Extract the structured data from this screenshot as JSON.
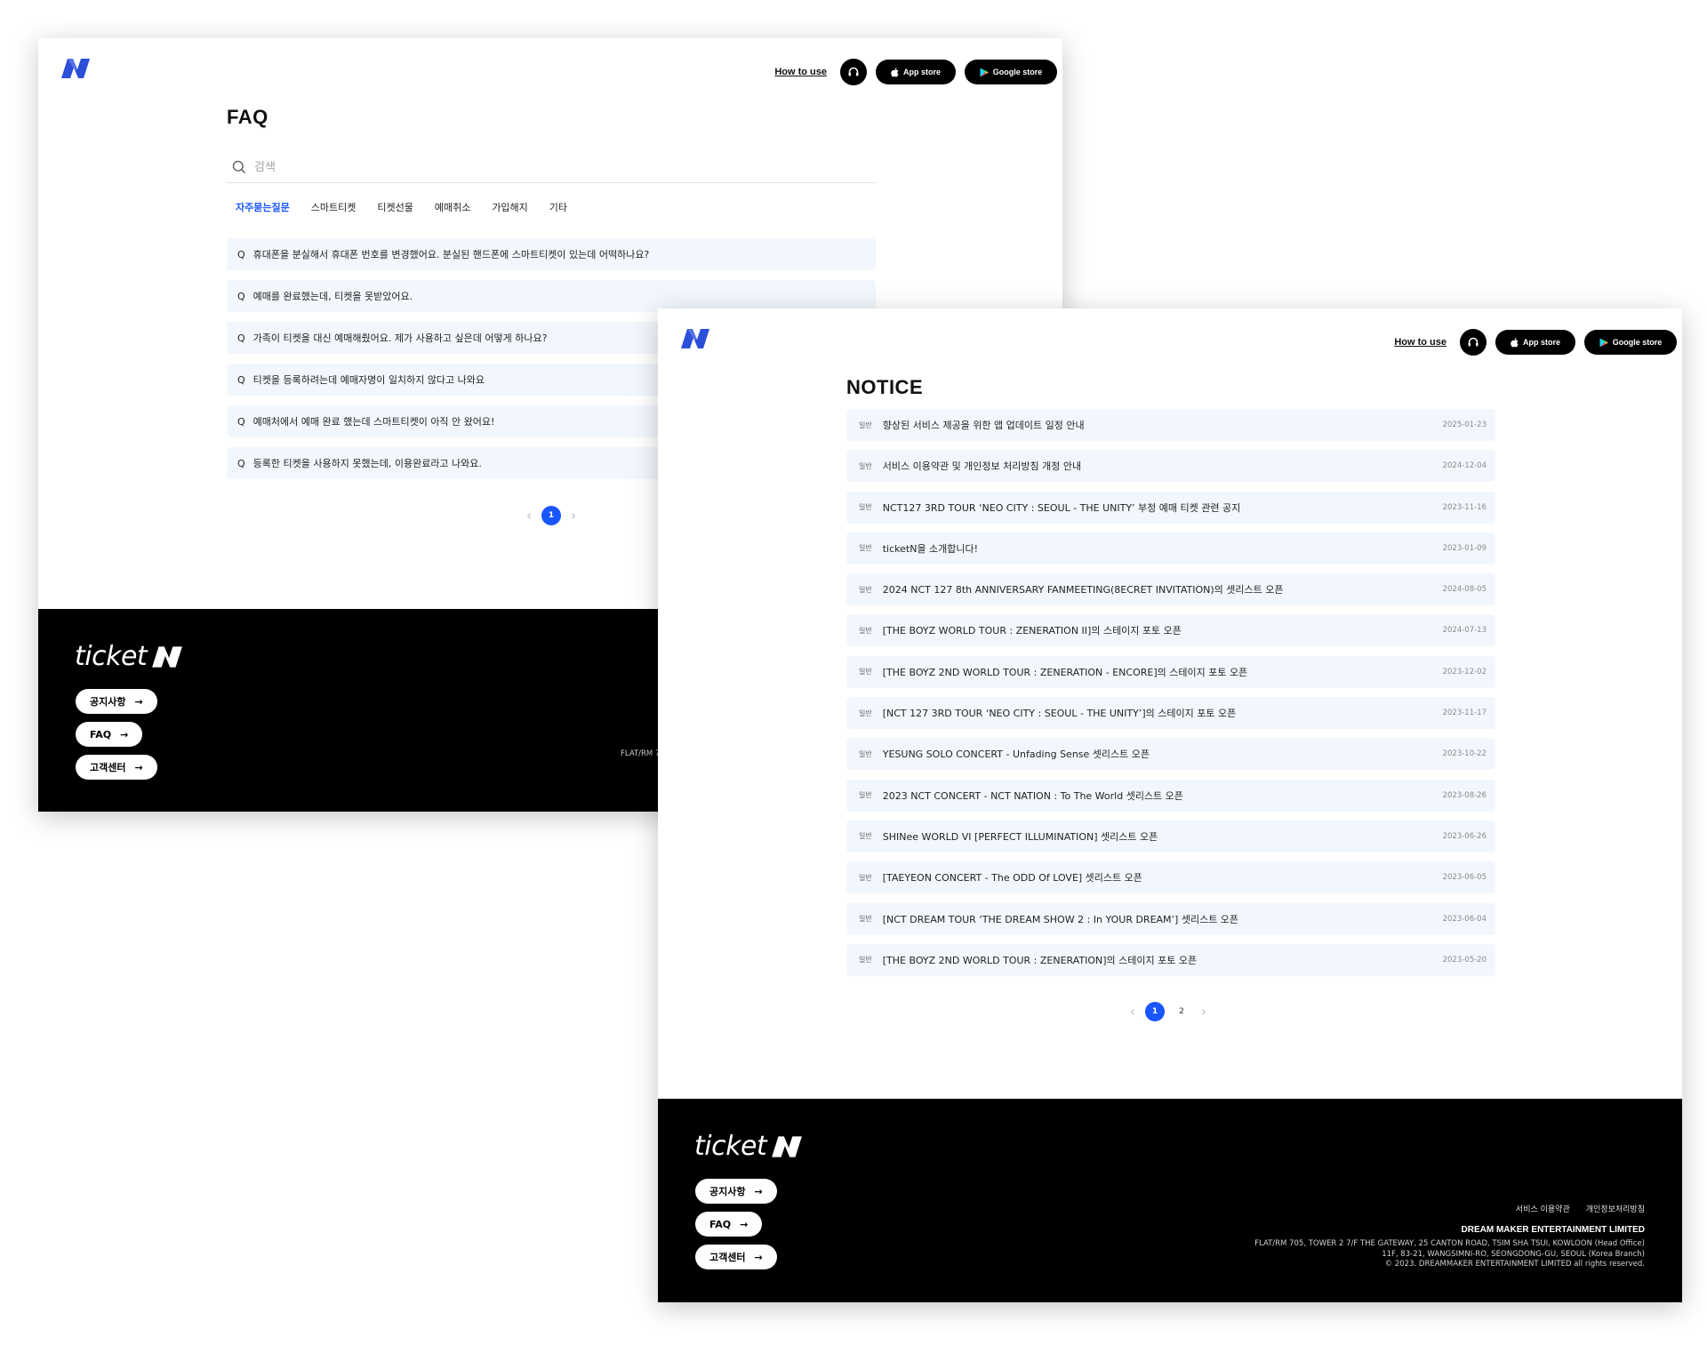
{
  "header": {
    "how_to_use": "How to use",
    "app_store": "App store",
    "google_store": "Google store"
  },
  "faq": {
    "title": "FAQ",
    "search_placeholder": "검색",
    "tabs": [
      "자주묻는질문",
      "스마트티켓",
      "티켓선물",
      "예매취소",
      "가입해지",
      "기타"
    ],
    "active_tab": "자주묻는질문",
    "items": [
      "휴대폰을 분실해서 휴대폰 번호를 변경했어요. 분실된 핸드폰에 스마트티켓이 있는데 어떡하나요?",
      "예매를 완료했는데, 티켓을 못받았어요.",
      "가족이 티켓을 대신 예매해줬어요. 제가 사용하고 싶은데 어떻게 하나요?",
      "티켓을 등록하려는데 예매자명이 일치하지 않다고 나와요",
      "예매처에서 예매 완료 했는데 스마트티켓이 아직 안 왔어요!",
      "등록한 티켓을 사용하지 못했는데, 이용완료라고 나와요."
    ],
    "q_prefix": "Q",
    "pages": [
      "1"
    ],
    "current_page": "1",
    "footer_addr_fragment": "FLAT/RM 7"
  },
  "notice": {
    "title": "NOTICE",
    "items": [
      {
        "category": "일반",
        "title": "향상된 서비스 제공을 위한 앱 업데이트 일정 안내",
        "date": "2025-01-23"
      },
      {
        "category": "일반",
        "title": "서비스 이용약관 및 개인정보 처리방침 개정 안내",
        "date": "2024-12-04"
      },
      {
        "category": "일반",
        "title": "NCT127 3RD TOUR ‘NEO CITY : SEOUL - THE UNITY’ 부정 예매 티켓 관련 공지",
        "date": "2023-11-16"
      },
      {
        "category": "일반",
        "title": "ticketN을 소개합니다!",
        "date": "2023-01-09"
      },
      {
        "category": "일반",
        "title": "2024 NCT 127 8th ANNIVERSARY FANMEETING(8ECRET INVITATION)의 셋리스트 오픈",
        "date": "2024-08-05"
      },
      {
        "category": "일반",
        "title": "[THE BOYZ WORLD TOUR : ZENERATION II]의 스테이지 포토 오픈",
        "date": "2024-07-13"
      },
      {
        "category": "일반",
        "title": "[THE BOYZ 2ND WORLD TOUR : ZENERATION - ENCORE]의 스테이지 포토 오픈",
        "date": "2023-12-02"
      },
      {
        "category": "일반",
        "title": "[NCT 127 3RD TOUR ‘NEO CITY : SEOUL - THE UNITY’]의 스테이지 포토 오픈",
        "date": "2023-11-17"
      },
      {
        "category": "일반",
        "title": "YESUNG SOLO CONCERT - Unfading Sense 셋리스트 오픈",
        "date": "2023-10-22"
      },
      {
        "category": "일반",
        "title": "2023 NCT CONCERT - NCT NATION : To The World 셋리스트 오픈",
        "date": "2023-08-26"
      },
      {
        "category": "일반",
        "title": "SHINee WORLD VI [PERFECT ILLUMINATION] 셋리스트 오픈",
        "date": "2023-06-26"
      },
      {
        "category": "일반",
        "title": "[TAEYEON CONCERT - The ODD Of LOVE] 셋리스트 오픈",
        "date": "2023-06-05"
      },
      {
        "category": "일반",
        "title": "[NCT DREAM TOUR ‘THE DREAM SHOW 2 : In YOUR DREAM’] 셋리스트 오픈",
        "date": "2023-06-04"
      },
      {
        "category": "일반",
        "title": "[THE BOYZ 2ND WORLD TOUR : ZENERATION]의 스테이지 포토 오픈",
        "date": "2023-05-20"
      }
    ],
    "pages": [
      "1",
      "2"
    ],
    "current_page": "1"
  },
  "footer": {
    "brand": "ticket",
    "links": [
      "공지사항",
      "FAQ",
      "고객센터"
    ],
    "terms": "서비스 이용약관",
    "privacy": "개인정보처리방침",
    "company": "DREAM MAKER ENTERTAINMENT LIMITED",
    "address_lines": [
      "FLAT/RM 705, TOWER 2 7/F THE GATEWAY, 25 CANTON ROAD, TSIM SHA TSUI, KOWLOON (Head Office)",
      "11F, 83-21, WANGSIMNI-RO, SEONGDONG-GU, SEOUL (Korea Branch)",
      "© 2023. DREAMMAKER ENTERTAINMENT LIMITED all rights reserved."
    ]
  },
  "colors": {
    "accent": "#1a56ff",
    "logo": "#2b4fd8",
    "row_bg": "#f2f7fd",
    "footer_bg": "#000000"
  },
  "icons": {
    "logo": "n-logo-icon",
    "customer_service": "headset-icon",
    "app_store": "apple-icon",
    "google_store": "google-play-icon",
    "search": "search-icon",
    "arrow": "arrow-right-icon"
  }
}
